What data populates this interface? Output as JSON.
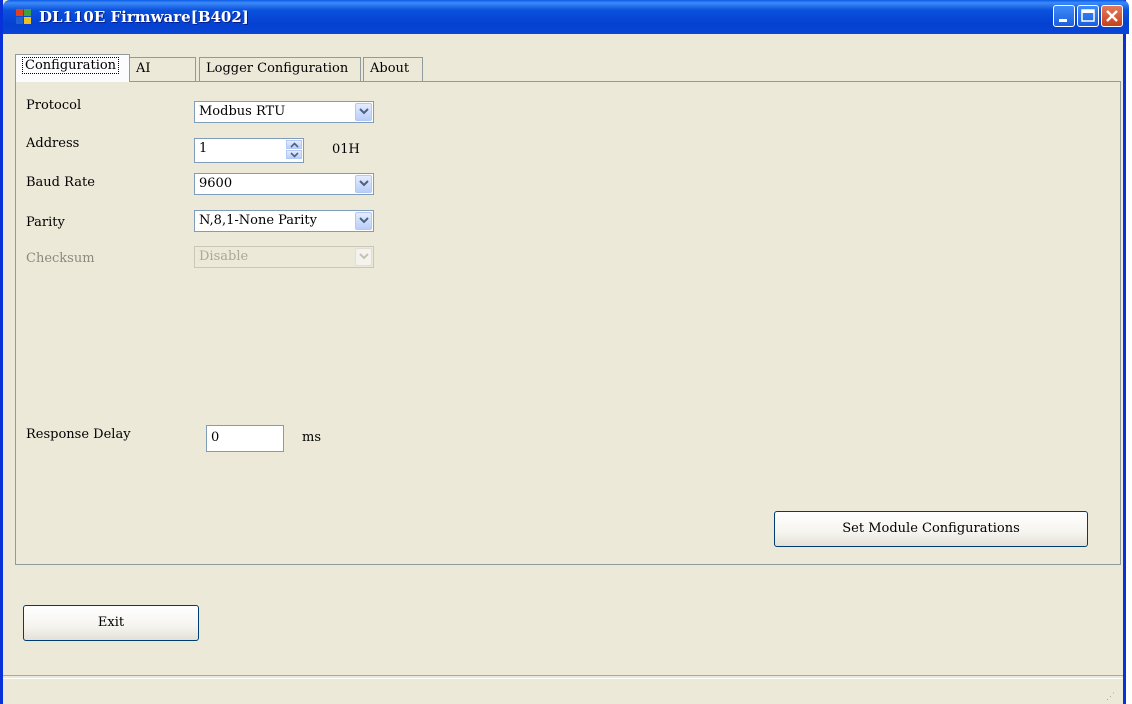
{
  "window": {
    "title": "DL110E Firmware[B402]",
    "icon": "app-window-icon"
  },
  "caption_buttons": {
    "minimize": "minimize-icon",
    "maximize": "maximize-icon",
    "close": "close-icon"
  },
  "tabs": [
    {
      "label": "Configuration",
      "active": true
    },
    {
      "label": "AI",
      "active": false
    },
    {
      "label": "Logger Configuration",
      "active": false
    },
    {
      "label": "About",
      "active": false
    }
  ],
  "form": {
    "protocol": {
      "label": "Protocol",
      "value": "Modbus RTU"
    },
    "address": {
      "label": "Address",
      "value": "1",
      "hex": "01H"
    },
    "baud_rate": {
      "label": "Baud Rate",
      "value": "9600"
    },
    "parity": {
      "label": "Parity",
      "value": "N,8,1-None Parity"
    },
    "checksum": {
      "label": "Checksum",
      "value": "Disable",
      "enabled": false
    },
    "response_delay": {
      "label": "Response Delay",
      "value": "0",
      "unit": "ms"
    }
  },
  "buttons": {
    "set_config": "Set Module Configurations",
    "exit": "Exit"
  },
  "colors": {
    "titlebar": "#0a52dd",
    "window_frame": "#0831d9",
    "dialog_bg": "#ece9d8",
    "close_button": "#c6401c"
  }
}
